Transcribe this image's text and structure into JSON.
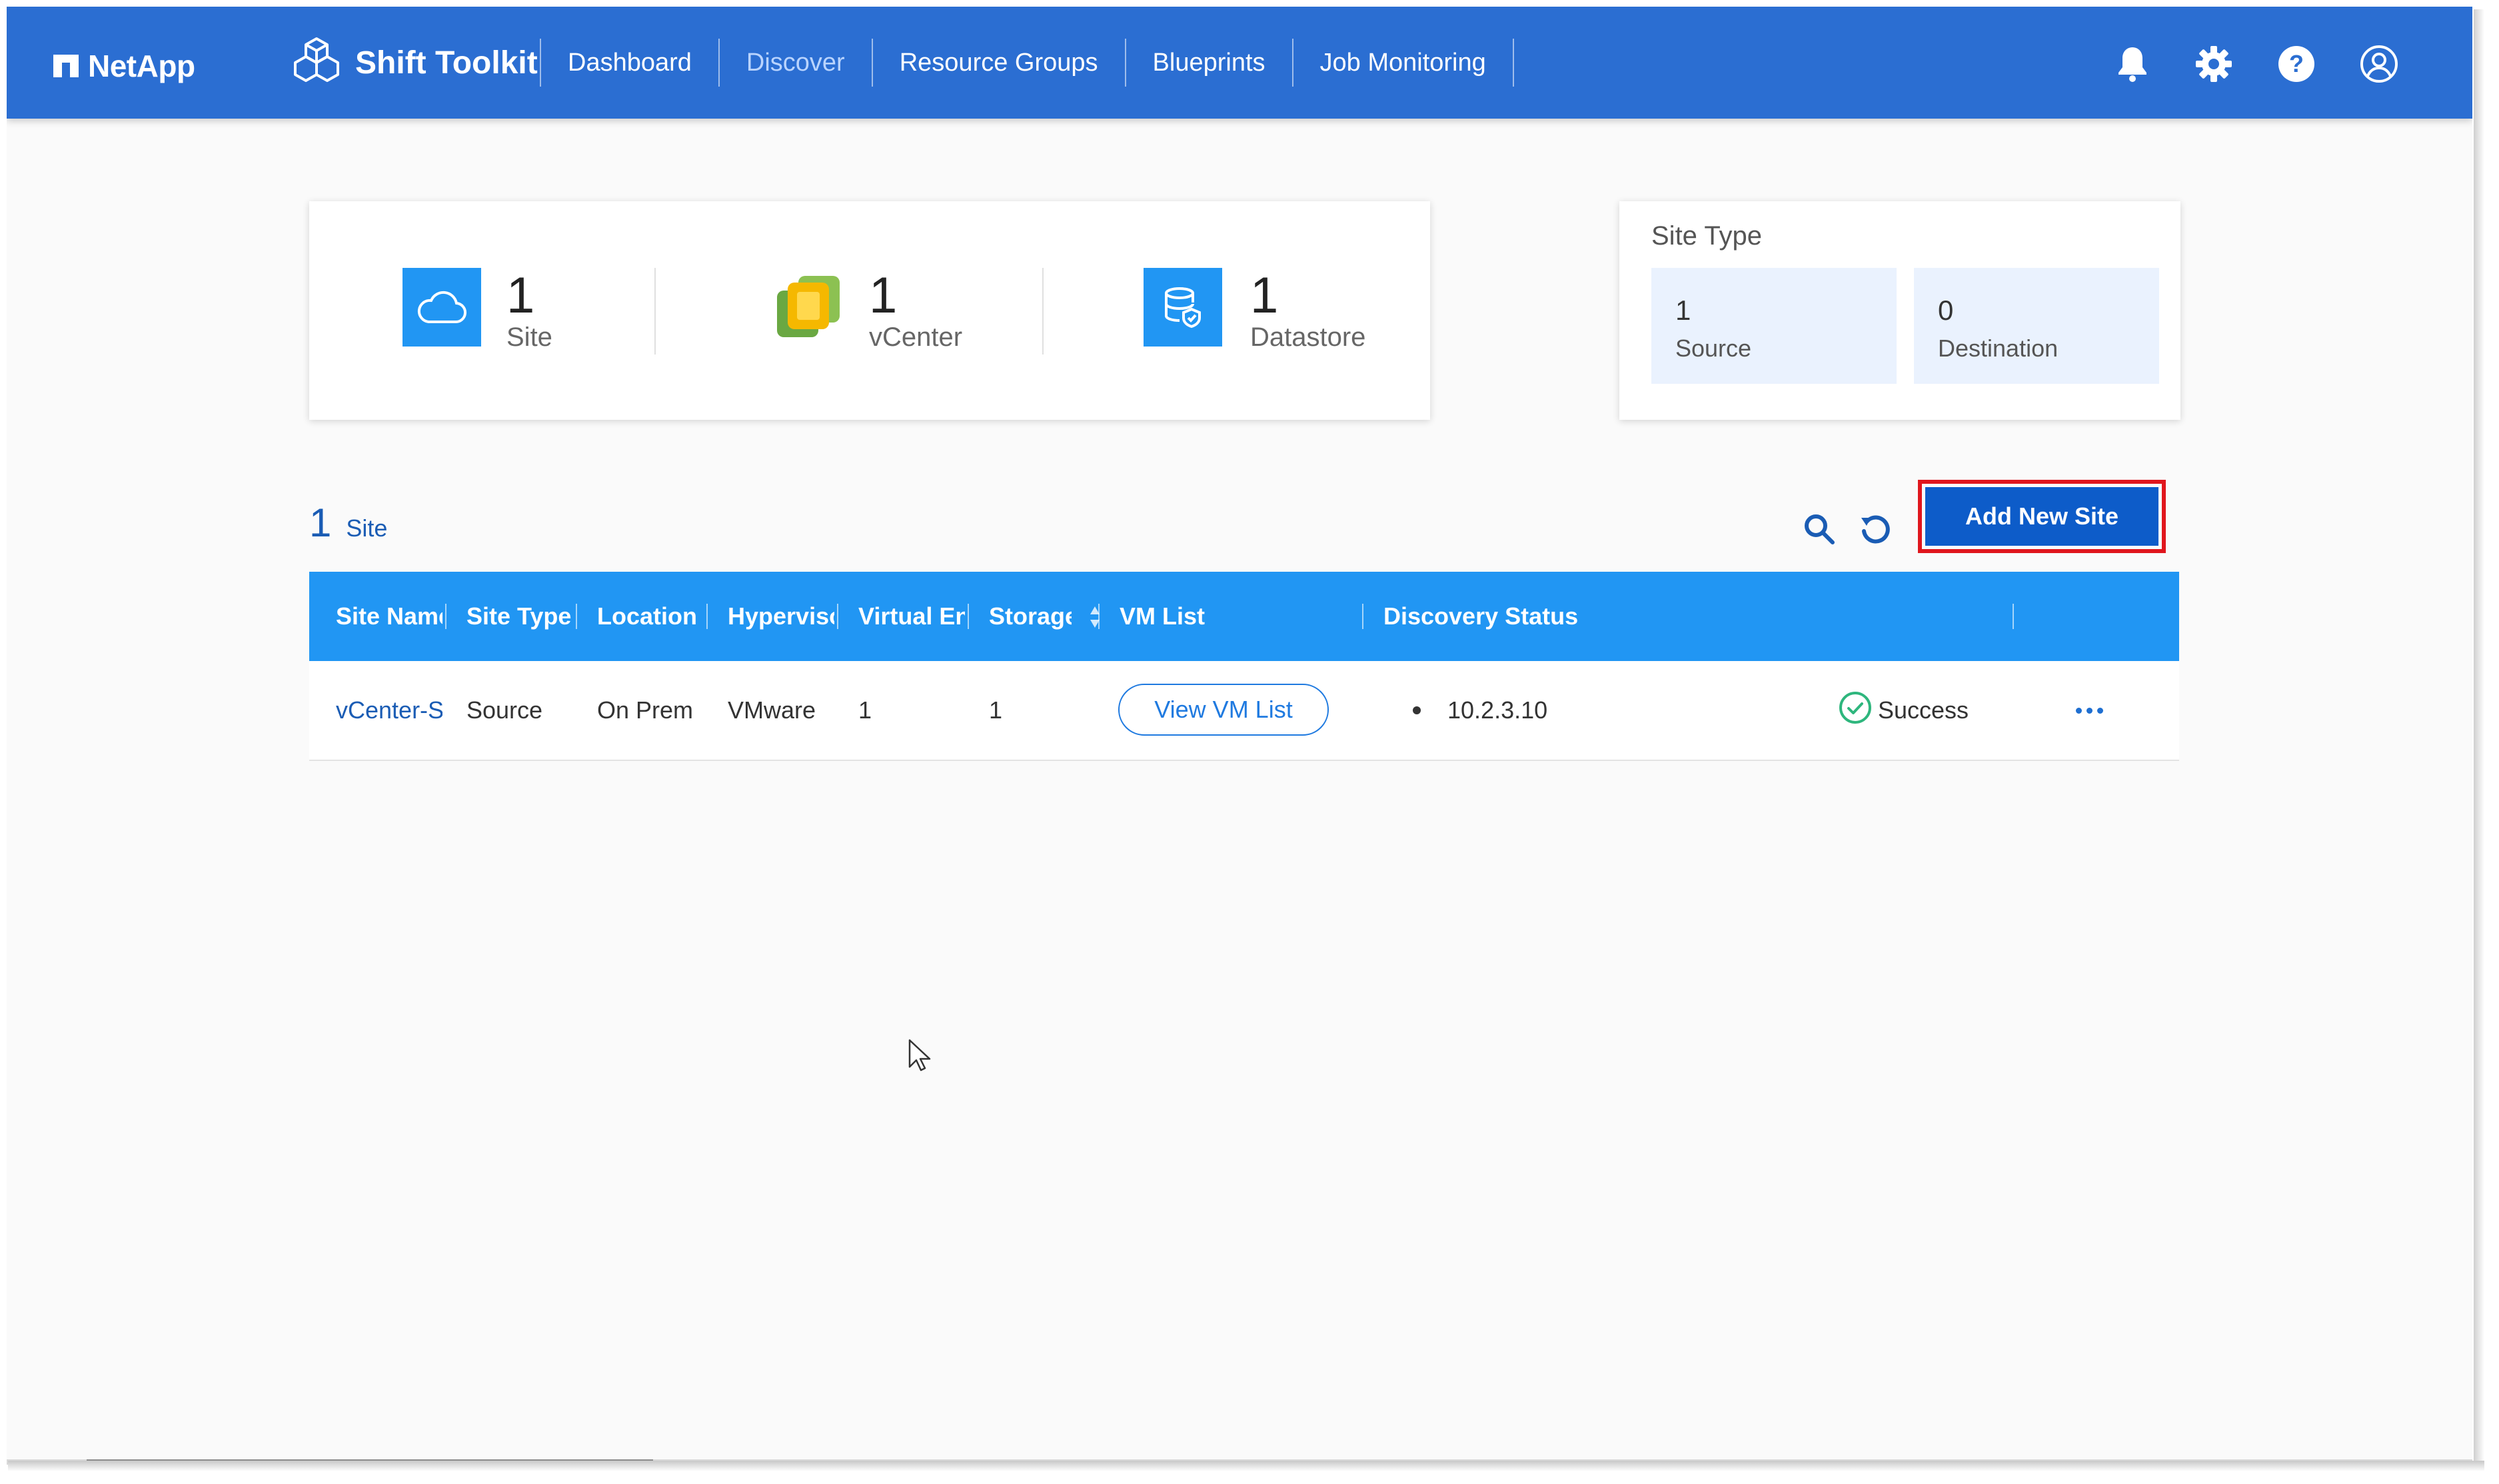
{
  "header": {
    "logo": "NetApp",
    "brand": "Shift Toolkit",
    "nav": [
      "Dashboard",
      "Discover",
      "Resource Groups",
      "Blueprints",
      "Job Monitoring"
    ],
    "active_nav": "Discover",
    "icons": [
      "bell-icon",
      "gear-icon",
      "help-icon",
      "user-icon"
    ]
  },
  "summary": {
    "site": {
      "count": "1",
      "label": "Site"
    },
    "vcenter": {
      "count": "1",
      "label": "vCenter"
    },
    "datastore": {
      "count": "1",
      "label": "Datastore"
    }
  },
  "site_type": {
    "title": "Site Type",
    "source": {
      "count": "1",
      "label": "Source"
    },
    "destination": {
      "count": "0",
      "label": "Destination"
    }
  },
  "list": {
    "count": "1",
    "count_label": "Site",
    "add_button": "Add New Site"
  },
  "table": {
    "columns": [
      "Site Name",
      "Site Type",
      "Location",
      "Hypervisor",
      "Virtual Environment",
      "Storage",
      "VM List",
      "Discovery Status"
    ],
    "rows": [
      {
        "site_name": "vCenter-Si",
        "site_type": "Source",
        "location": "On Prem",
        "hypervisor": "VMware",
        "virtual_env": "1",
        "storage": "1",
        "vm_list_button": "View VM List",
        "discovery_ip": "10.2.3.10",
        "status": "Success"
      }
    ]
  },
  "colors": {
    "header_bg": "#2b6ed2",
    "table_header_bg": "#2196f3",
    "primary_button": "#0d5cc9",
    "highlight_border": "#e0161d",
    "success": "#2eb67d"
  }
}
